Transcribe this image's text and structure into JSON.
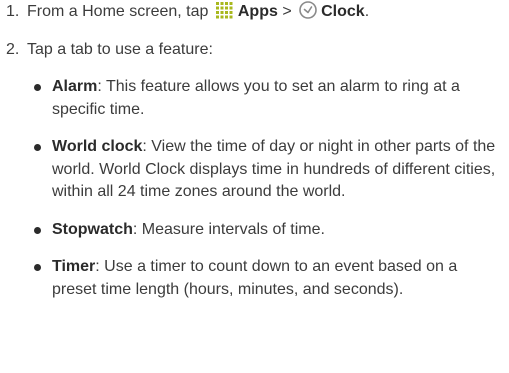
{
  "step1": {
    "number": "1.",
    "text_before": "From a Home screen, tap",
    "apps_label": "Apps",
    "separator": ">",
    "clock_label": "Clock",
    "end": ".",
    "apps_icon": "apps-grid-icon",
    "clock_icon": "clock-icon"
  },
  "step2": {
    "number": "2.",
    "text": "Tap a tab to use a feature:"
  },
  "bullets": [
    {
      "term": "Alarm",
      "text": ": This feature allows you to set an alarm to ring at a specific time."
    },
    {
      "term": "World clock",
      "text": ": View the time of day or night in other parts of the world. World Clock displays time in hundreds of different cities, within all 24 time zones around the world."
    },
    {
      "term": "Stopwatch",
      "text": ": Measure intervals of time."
    },
    {
      "term": "Timer",
      "text": ": Use a timer to count down to an event based on a preset time length (hours, minutes, and seconds)."
    }
  ],
  "colors": {
    "text": "#3c3c3c",
    "bold": "#2b2b2b",
    "apps_icon": "#a8b81e",
    "clock_icon": "#8a8a8a"
  }
}
